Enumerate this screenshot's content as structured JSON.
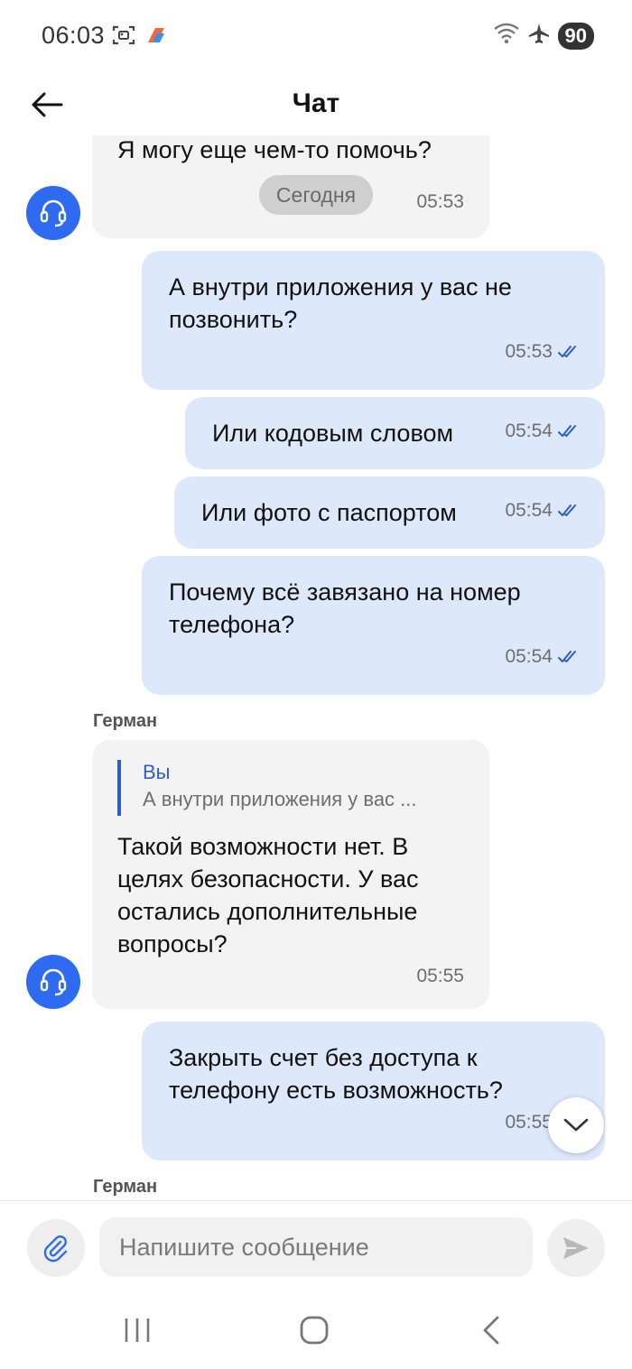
{
  "status_bar": {
    "time": "06:03",
    "battery": "90",
    "left_icons": [
      "screenshot-icon",
      "app-notification-icon"
    ],
    "right_icons": [
      "wifi-icon",
      "airplane-mode-icon",
      "battery-icon"
    ]
  },
  "header": {
    "title": "Чат",
    "back_icon": "arrow-left-icon"
  },
  "chat": {
    "date_divider": "Сегодня",
    "messages": [
      {
        "direction": "in",
        "text": "Я могу еще чем-то помочь?",
        "time": "05:53"
      },
      {
        "direction": "out",
        "text": "А внутри приложения у вас не позвонить?",
        "time": "05:53",
        "status": "read"
      },
      {
        "direction": "out",
        "text": "Или кодовым словом",
        "time": "05:54",
        "status": "read"
      },
      {
        "direction": "out",
        "text": "Или фото с паспортом",
        "time": "05:54",
        "status": "read"
      },
      {
        "direction": "out",
        "text": "Почему всё завязано на номер телефона?",
        "time": "05:54",
        "status": "read"
      },
      {
        "direction": "in",
        "sender": "Герман",
        "reply_to": {
          "author": "Вы",
          "preview": "А внутри приложения у вас ..."
        },
        "text": "Такой возможности нет. В целях безопасности. У вас остались дополнительные вопросы?",
        "time": "05:55"
      },
      {
        "direction": "out",
        "text": "Закрыть счет без доступа к телефону есть возможность?",
        "time": "05:55",
        "status": "read"
      }
    ],
    "last_sender": "Герман"
  },
  "composer": {
    "placeholder": "Напишите сообщение"
  },
  "colors": {
    "accent": "#2f6bf0",
    "outgoing_bubble": "#dde8fb",
    "incoming_bubble": "#f3f3f3"
  }
}
